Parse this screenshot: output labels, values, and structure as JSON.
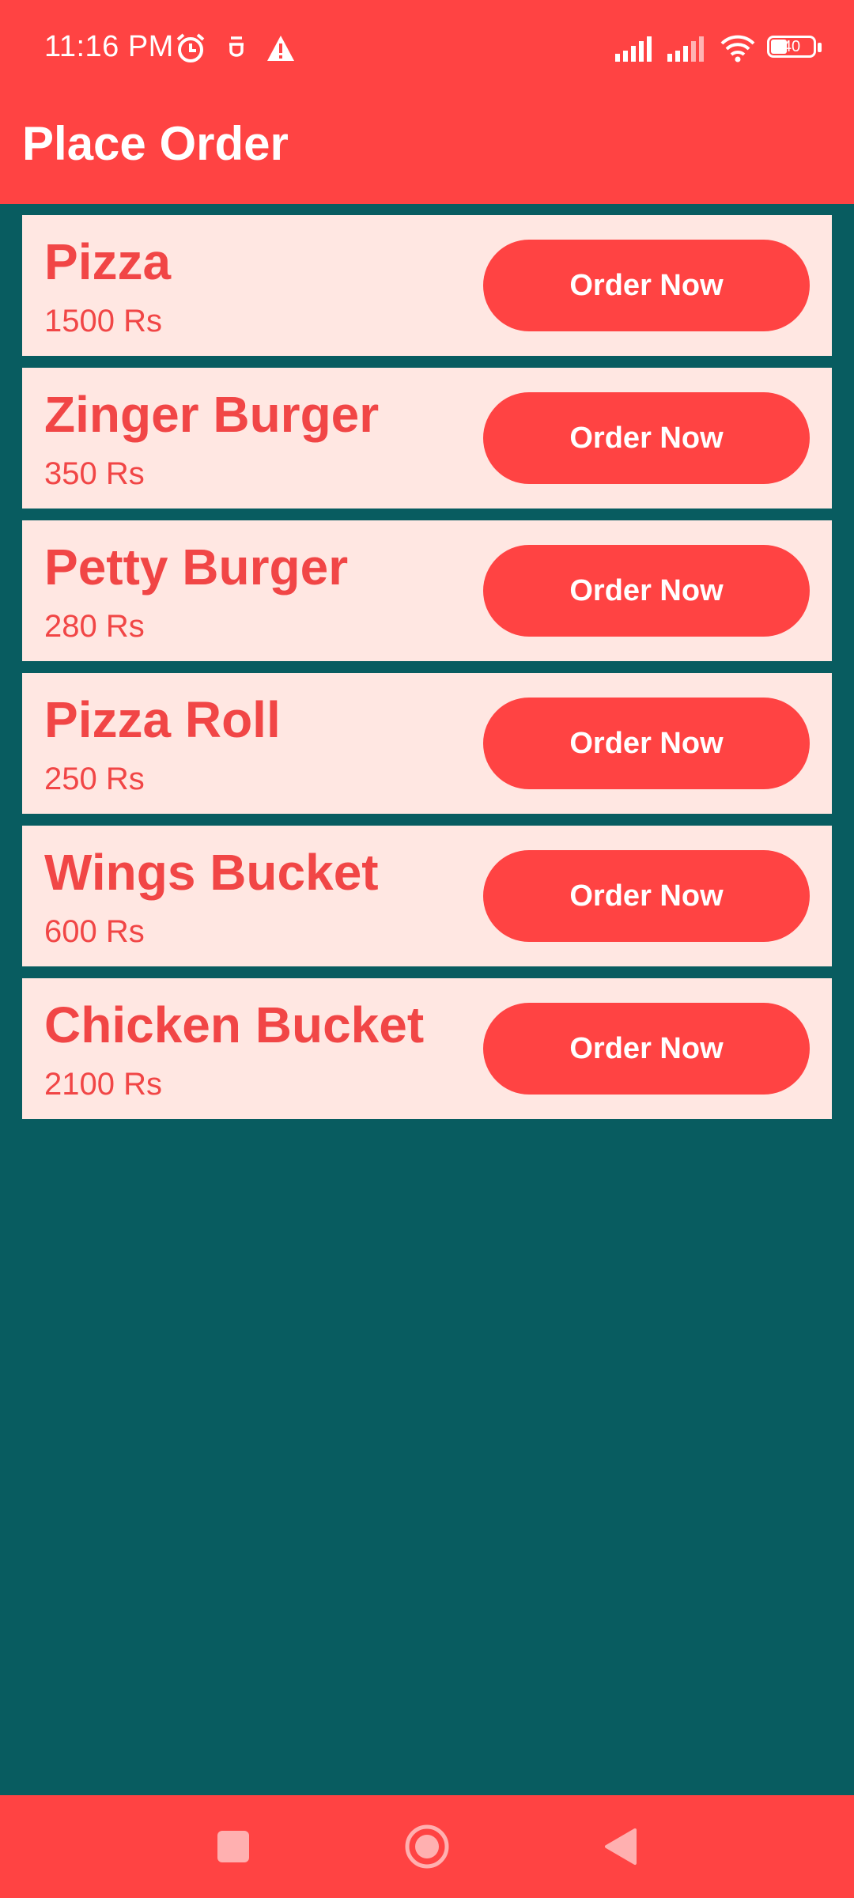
{
  "status_bar": {
    "time": "11:16 PM",
    "battery": "40",
    "icons": [
      "alarm-icon",
      "notification-icon",
      "warning-icon",
      "signal-icon",
      "signal-icon-2",
      "wifi-icon",
      "battery-icon"
    ]
  },
  "app_bar": {
    "title": "Place Order"
  },
  "menu": {
    "items": [
      {
        "name": "Pizza",
        "price": "1500 Rs",
        "button": "Order Now"
      },
      {
        "name": "Zinger Burger",
        "price": "350 Rs",
        "button": "Order Now"
      },
      {
        "name": "Petty Burger",
        "price": "280 Rs",
        "button": "Order Now"
      },
      {
        "name": "Pizza Roll",
        "price": "250 Rs",
        "button": "Order Now"
      },
      {
        "name": "Wings Bucket",
        "price": "600 Rs",
        "button": "Order Now"
      },
      {
        "name": "Chicken Bucket",
        "price": "2100 Rs",
        "button": "Order Now"
      }
    ]
  },
  "nav_bar": {
    "buttons": [
      "recents-icon",
      "home-icon",
      "back-icon"
    ]
  },
  "colors": {
    "primary": "#FF4343",
    "background": "#085C60",
    "card": "#FFE7E2",
    "text_accent": "#F14646"
  }
}
